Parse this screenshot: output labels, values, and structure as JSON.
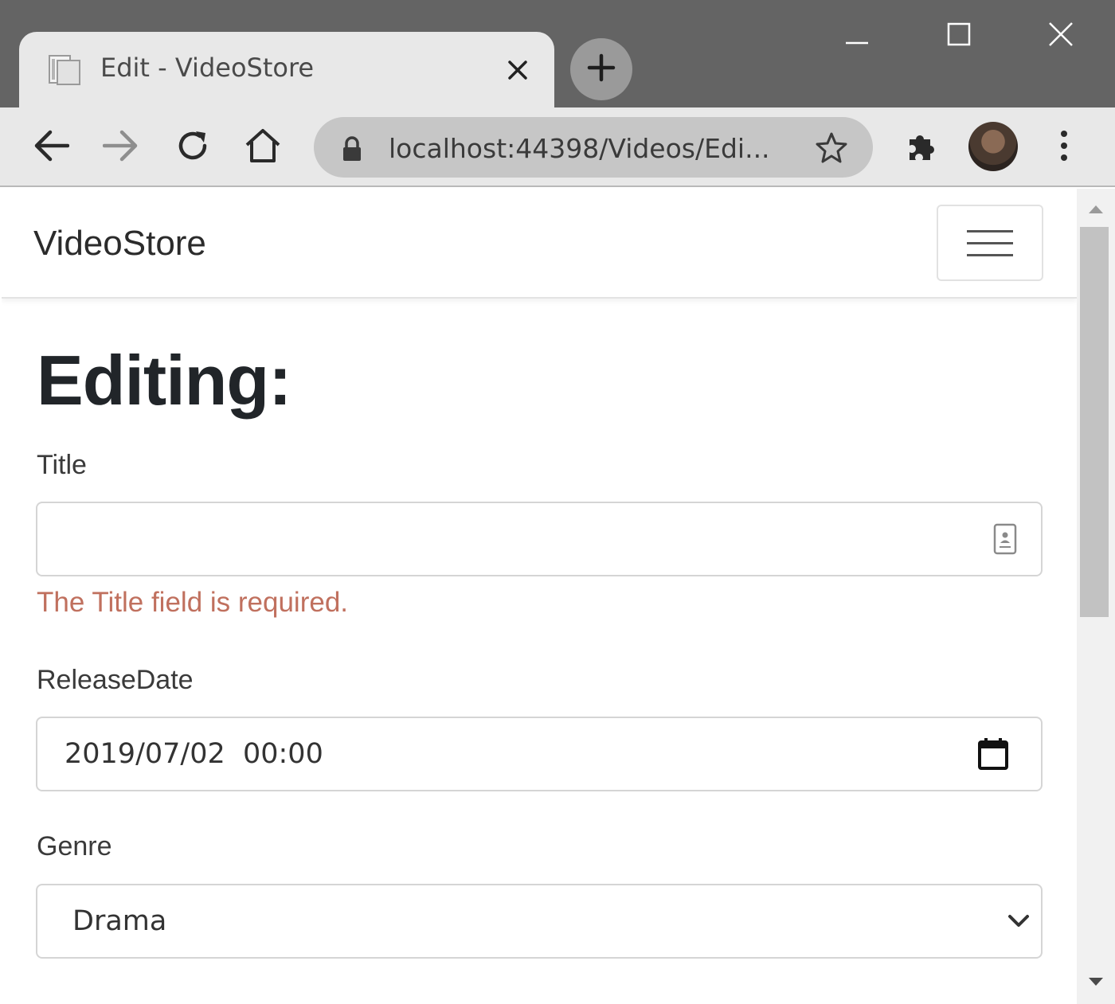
{
  "browser": {
    "tab_title": "Edit - VideoStore",
    "url": "localhost:44398/Videos/Edi..."
  },
  "icons": {
    "tab_favicon": "page-icon",
    "tab_close": "close-icon",
    "new_tab": "plus-icon",
    "minimize": "minimize-icon",
    "maximize": "maximize-icon",
    "close_window": "close-icon",
    "back": "arrow-left-icon",
    "forward": "arrow-right-icon",
    "reload": "reload-icon",
    "home": "home-icon",
    "lock": "lock-icon",
    "bookmark": "star-icon",
    "extensions": "puzzle-icon",
    "menu": "kebab-menu-icon"
  },
  "navbar": {
    "brand": "VideoStore"
  },
  "page": {
    "heading": "Editing:"
  },
  "form": {
    "title_label": "Title",
    "title_value": "",
    "title_error": "The Title field is required.",
    "release_label": "ReleaseDate",
    "release_value": "2019/07/02  00:00",
    "genre_label": "Genre",
    "genre_selected": "Drama"
  },
  "colors": {
    "validation_error": "#c0705e",
    "titlebar": "#646464",
    "toolbar": "#e8e8e8"
  }
}
